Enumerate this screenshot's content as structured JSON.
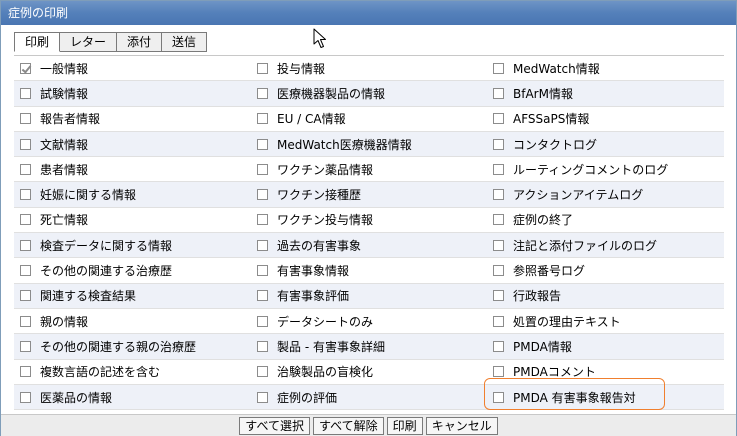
{
  "window": {
    "title": "症例の印刷"
  },
  "tabs": [
    {
      "label": "印刷",
      "active": true
    },
    {
      "label": "レター",
      "active": false
    },
    {
      "label": "添付",
      "active": false
    },
    {
      "label": "送信",
      "active": false
    }
  ],
  "rows": [
    [
      {
        "label": "一般情報",
        "checked": true
      },
      {
        "label": "投与情報",
        "checked": false
      },
      {
        "label": "MedWatch情報",
        "checked": false
      }
    ],
    [
      {
        "label": "試験情報",
        "checked": false
      },
      {
        "label": "医療機器製品の情報",
        "checked": false
      },
      {
        "label": "BfArM情報",
        "checked": false
      }
    ],
    [
      {
        "label": "報告者情報",
        "checked": false
      },
      {
        "label": "EU / CA情報",
        "checked": false
      },
      {
        "label": "AFSSaPS情報",
        "checked": false
      }
    ],
    [
      {
        "label": "文献情報",
        "checked": false
      },
      {
        "label": "MedWatch医療機器情報",
        "checked": false
      },
      {
        "label": "コンタクトログ",
        "checked": false
      }
    ],
    [
      {
        "label": "患者情報",
        "checked": false
      },
      {
        "label": "ワクチン薬品情報",
        "checked": false
      },
      {
        "label": "ルーティングコメントのログ",
        "checked": false
      }
    ],
    [
      {
        "label": "妊娠に関する情報",
        "checked": false
      },
      {
        "label": "ワクチン接種歴",
        "checked": false
      },
      {
        "label": "アクションアイテムログ",
        "checked": false
      }
    ],
    [
      {
        "label": "死亡情報",
        "checked": false
      },
      {
        "label": "ワクチン投与情報",
        "checked": false
      },
      {
        "label": "症例の終了",
        "checked": false
      }
    ],
    [
      {
        "label": "検査データに関する情報",
        "checked": false
      },
      {
        "label": "過去の有害事象",
        "checked": false
      },
      {
        "label": "注記と添付ファイルのログ",
        "checked": false
      }
    ],
    [
      {
        "label": "その他の関連する治療歴",
        "checked": false
      },
      {
        "label": "有害事象情報",
        "checked": false
      },
      {
        "label": "参照番号ログ",
        "checked": false
      }
    ],
    [
      {
        "label": "関連する検査結果",
        "checked": false
      },
      {
        "label": "有害事象評価",
        "checked": false
      },
      {
        "label": "行政報告",
        "checked": false
      }
    ],
    [
      {
        "label": "親の情報",
        "checked": false
      },
      {
        "label": "データシートのみ",
        "checked": false
      },
      {
        "label": "処置の理由テキスト",
        "checked": false
      }
    ],
    [
      {
        "label": "その他の関連する親の治療歴",
        "checked": false
      },
      {
        "label": "製品 - 有害事象詳細",
        "checked": false
      },
      {
        "label": "PMDA情報",
        "checked": false
      }
    ],
    [
      {
        "label": "複数言語の記述を含む",
        "checked": false
      },
      {
        "label": "治験製品の盲検化",
        "checked": false
      },
      {
        "label": "PMDAコメント",
        "checked": false
      }
    ],
    [
      {
        "label": "医薬品の情報",
        "checked": false
      },
      {
        "label": "症例の評価",
        "checked": false
      },
      {
        "label": "PMDA 有害事象報告対",
        "checked": false
      }
    ]
  ],
  "footer": {
    "select_all": "すべて選択",
    "clear_all": "すべて解除",
    "print": "印刷",
    "cancel": "キャンセル"
  },
  "colors": {
    "title_bar": "#5480ba",
    "row_alt": "#eef1f8",
    "highlight": "#f07f2e"
  }
}
